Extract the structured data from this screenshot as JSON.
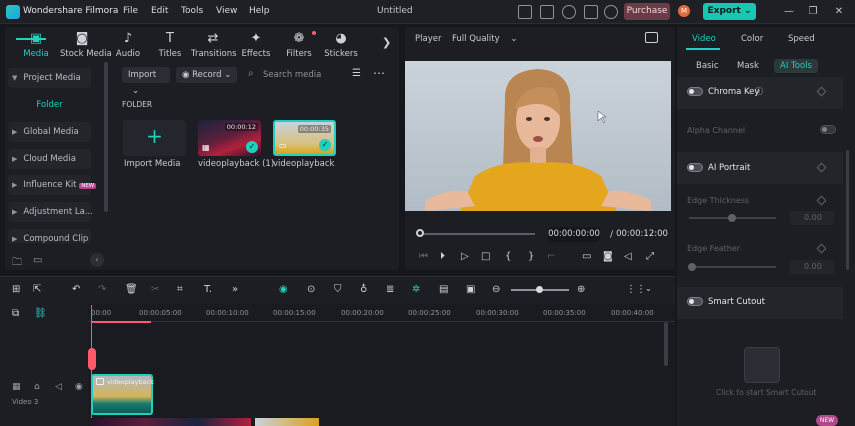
{
  "app": {
    "name": "Wondershare Filmora",
    "doc_title": "Untitled",
    "avatar_initial": "M"
  },
  "menu": [
    "File",
    "Edit",
    "Tools",
    "View",
    "Help"
  ],
  "titlebar": {
    "purchase_label": "Purchase",
    "export_label": "Export",
    "export_chevron": "⌄"
  },
  "media_tools": [
    {
      "label": "Media",
      "icon": "media-icon",
      "glyph": "▣"
    },
    {
      "label": "Stock Media",
      "icon": "stock-media-icon",
      "glyph": "◙"
    },
    {
      "label": "Audio",
      "icon": "audio-icon",
      "glyph": "♪"
    },
    {
      "label": "Titles",
      "icon": "titles-icon",
      "glyph": "T"
    },
    {
      "label": "Transitions",
      "icon": "transitions-icon",
      "glyph": "⇄"
    },
    {
      "label": "Effects",
      "icon": "effects-icon",
      "glyph": "✦"
    },
    {
      "label": "Filters",
      "icon": "filters-icon",
      "glyph": "❁"
    },
    {
      "label": "Stickers",
      "icon": "stickers-icon",
      "glyph": "◕"
    }
  ],
  "sidebar": {
    "project_media": "Project Media",
    "folder": "Folder",
    "items": [
      "Global Media",
      "Cloud Media",
      "Influence Kit",
      "Adjustment La...",
      "Compound Clip"
    ],
    "influence_badge": "NEW"
  },
  "media_bar": {
    "import_label": "Import",
    "record_label": "Record",
    "search_placeholder": "Search media"
  },
  "library": {
    "folder_label": "FOLDER",
    "import_tile_label": "Import Media",
    "clips": [
      {
        "name": "videoplayback (1)",
        "duration": "00:00:12"
      },
      {
        "name": "videoplayback",
        "duration": "00:00:35"
      }
    ]
  },
  "player": {
    "label": "Player",
    "quality": "Full Quality",
    "current_time": "00:00:00:00",
    "separator": "/",
    "total_time": "00:00:12:00"
  },
  "right_panel": {
    "tabs": [
      "Video",
      "Color",
      "Speed"
    ],
    "subtabs": [
      "Basic",
      "Mask",
      "AI Tools"
    ],
    "chroma_key": "Chroma Key",
    "alpha_channel": "Alpha Channel",
    "ai_portrait": "AI Portrait",
    "edge_thickness": "Edge Thickness",
    "edge_thickness_value": "0.00",
    "edge_feather": "Edge Feather",
    "edge_feather_value": "0.00",
    "smart_cutout": "Smart Cutout",
    "smart_cutout_hint": "Click to start Smart Cutout",
    "smart_new_badge": "NEW"
  },
  "timeline": {
    "ruler": [
      "00:00",
      "00:00:05:00",
      "00:00:10:00",
      "00:00:15:00",
      "00:00:20:00",
      "00:00:25:00",
      "00:00:30:00",
      "00:00:35:00",
      "00:00:40:00"
    ],
    "track_label": "Video 3",
    "clip_label": "videoplayback"
  },
  "colors": {
    "accent": "#21d0bf",
    "purchase": "#6b3b48",
    "export": "#16c7b1",
    "playhead": "#ff5a6b"
  }
}
